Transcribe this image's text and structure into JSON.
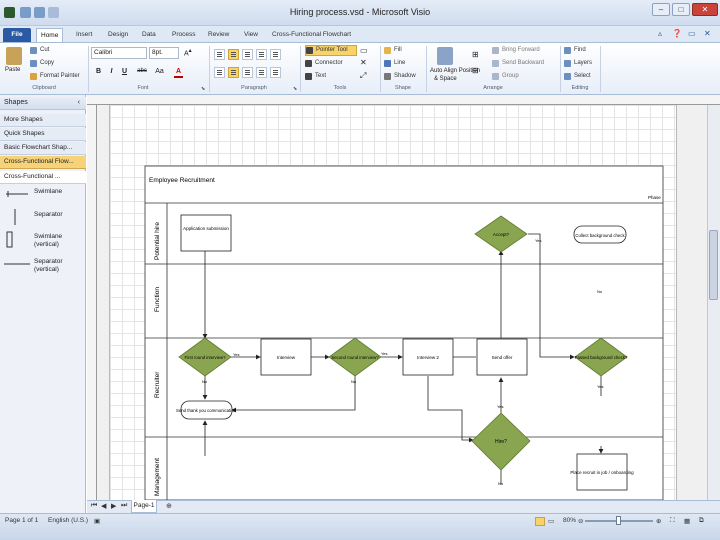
{
  "window": {
    "title": "Hiring process.vsd - Microsoft Visio",
    "min": "–",
    "max": "□",
    "close": "✕"
  },
  "tabs": [
    "File",
    "Home",
    "Insert",
    "Design",
    "Data",
    "Process",
    "Review",
    "View",
    "Cross-Functional Flowchart"
  ],
  "ribbon": {
    "clipboard": {
      "paste": "Paste",
      "cut": "Cut",
      "copy": "Copy",
      "format_painter": "Format Painter",
      "label": "Clipboard"
    },
    "font": {
      "name": "Calibri",
      "size": "8pt.",
      "label": "Font",
      "bold": "B",
      "italic": "I",
      "underline": "U",
      "strike": "abc",
      "case": "Aa",
      "color": "A"
    },
    "paragraph": {
      "label": "Paragraph"
    },
    "tools": {
      "pointer": "Pointer Tool",
      "connector": "Connector",
      "text": "Text",
      "label": "Tools"
    },
    "shape": {
      "fill": "Fill",
      "line": "Line",
      "shadow": "Shadow",
      "label": "Shape"
    },
    "arrange": {
      "auto_align": "Auto Align Position",
      "spacing": "& Space",
      "bring_forward": "Bring Forward",
      "send_backward": "Send Backward",
      "group": "Group",
      "label": "Arrange"
    },
    "editing": {
      "find": "Find",
      "layers": "Layers",
      "select": "Select",
      "label": "Editing"
    }
  },
  "shapes_panel": {
    "title": "Shapes",
    "items": [
      "More Shapes",
      "Quick Shapes",
      "Basic Flowchart Shap...",
      "Cross-Functional Flow..."
    ],
    "selected_index": 3,
    "stencil_title": "Cross-Functional ...",
    "stencil_items": [
      "Swimlane",
      "Separator",
      "Swimlane (vertical)",
      "Separator (vertical)"
    ]
  },
  "diagram": {
    "title": "Employee Recruitment",
    "phase": "Phase",
    "lanes": [
      "Potential hire",
      "Function",
      "Recruiter",
      "Management"
    ],
    "shapes": {
      "app": "Application submission",
      "first": "First round interview?",
      "interview": "Interview",
      "second": "Second round interview?",
      "interview2": "Interview 2",
      "offer": "Send offer",
      "accept": "Accept?",
      "bg_check": "Collect background check",
      "passed": "Passed background check?",
      "thanks": "Send thank you communication",
      "hire": "Hire?",
      "place": "Place recruit in job / onboarding"
    },
    "labels": {
      "yes": "Yes",
      "no": "No"
    }
  },
  "bottom": {
    "page_tab": "Page-1"
  },
  "status": {
    "page": "Page 1 of 1",
    "lang": "English (U.S.)",
    "zoom": "80%"
  }
}
